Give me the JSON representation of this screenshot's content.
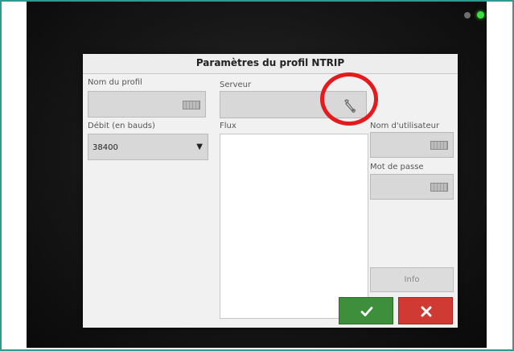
{
  "dialog": {
    "title": "Paramètres du profil NTRIP",
    "profile_name": {
      "label": "Nom du profil",
      "value": ""
    },
    "baud_rate": {
      "label": "Débit (en bauds)",
      "value": "38400"
    },
    "server": {
      "label": "Serveur",
      "value": ""
    },
    "flux": {
      "label": "Flux"
    },
    "username": {
      "label": "Nom d'utilisateur",
      "value": ""
    },
    "password": {
      "label": "Mot de passe",
      "value": ""
    },
    "info_label": "Info"
  },
  "icons": {
    "keyboard": "keyboard-icon",
    "wrench": "wrench-icon",
    "confirm": "checkmark-icon",
    "cancel": "x-icon"
  },
  "colors": {
    "frame_border": "#2f9a8e",
    "confirm_button": "#3e8f3c",
    "cancel_button": "#cf3a32",
    "highlight_circle": "#e6191c",
    "status_led": "#38e23a"
  }
}
